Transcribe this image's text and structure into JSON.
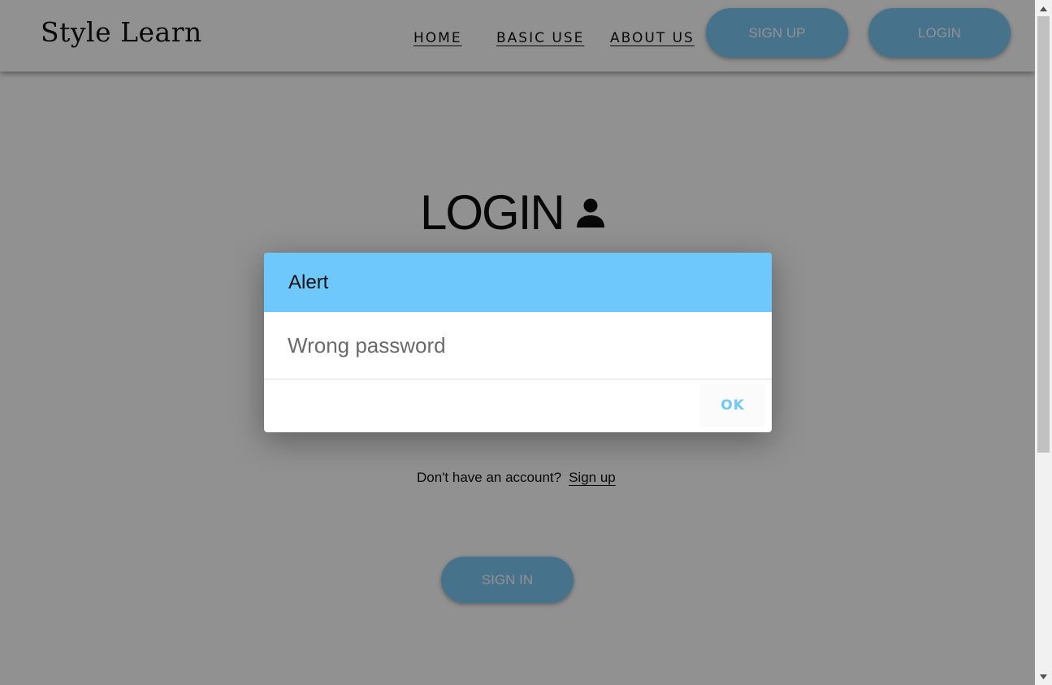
{
  "nav": {
    "logo": "Style Learn",
    "links": [
      "HOME",
      "BASIC USE",
      "ABOUT US"
    ],
    "signup_label": "SIGN UP",
    "login_label": "LOGIN"
  },
  "login": {
    "title": "LOGIN",
    "signup_prompt": "Don't have an account?",
    "signup_link": "Sign up",
    "signin_label": "SIGN IN"
  },
  "dialog": {
    "title": "Alert",
    "message": "Wrong password",
    "ok_label": "OK"
  },
  "colors": {
    "accent": "#6ec8fb",
    "button": "#7ec8f5",
    "overlay": "rgba(0,0,0,0.43)"
  },
  "icons": {
    "title_icon": "person-icon",
    "scroll_up": "triangle-up-icon",
    "scroll_down": "triangle-down-icon"
  }
}
